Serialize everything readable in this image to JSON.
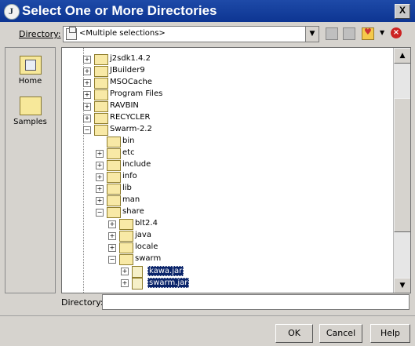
{
  "window": {
    "title": "Select One or More Directories",
    "close": "X"
  },
  "toolbar": {
    "directory_label": "Directory:",
    "combo_value": "<Multiple selections>",
    "combo_arrow": "▼",
    "fav_arrow": "▼",
    "delete_symbol": "×"
  },
  "places": [
    {
      "label": "Home",
      "icon": "home-folder-icon"
    },
    {
      "label": "Samples",
      "icon": "folder-icon"
    }
  ],
  "tree": {
    "nodes": [
      {
        "label": "j2sdk1.4.2",
        "level": 0,
        "expander": "+",
        "type": "folder"
      },
      {
        "label": "JBuilder9",
        "level": 0,
        "expander": "+",
        "type": "folder"
      },
      {
        "label": "MSOCache",
        "level": 0,
        "expander": "+",
        "type": "folder"
      },
      {
        "label": "Program Files",
        "level": 0,
        "expander": "+",
        "type": "folder"
      },
      {
        "label": "RAVBIN",
        "level": 0,
        "expander": "+",
        "type": "folder"
      },
      {
        "label": "RECYCLER",
        "level": 0,
        "expander": "+",
        "type": "folder"
      },
      {
        "label": "Swarm-2.2",
        "level": 0,
        "expander": "−",
        "type": "folder"
      },
      {
        "label": "bin",
        "level": 1,
        "expander": "",
        "type": "folder"
      },
      {
        "label": "etc",
        "level": 1,
        "expander": "+",
        "type": "folder"
      },
      {
        "label": "include",
        "level": 1,
        "expander": "+",
        "type": "folder"
      },
      {
        "label": "info",
        "level": 1,
        "expander": "+",
        "type": "folder"
      },
      {
        "label": "lib",
        "level": 1,
        "expander": "+",
        "type": "folder"
      },
      {
        "label": "man",
        "level": 1,
        "expander": "+",
        "type": "folder"
      },
      {
        "label": "share",
        "level": 1,
        "expander": "−",
        "type": "folder"
      },
      {
        "label": "blt2.4",
        "level": 2,
        "expander": "+",
        "type": "folder"
      },
      {
        "label": "java",
        "level": 2,
        "expander": "+",
        "type": "folder"
      },
      {
        "label": "locale",
        "level": 2,
        "expander": "+",
        "type": "folder"
      },
      {
        "label": "swarm",
        "level": 2,
        "expander": "−",
        "type": "folder"
      },
      {
        "label": "kawa.jar",
        "level": 3,
        "expander": "+",
        "type": "file",
        "selected": true
      },
      {
        "label": "swarm.jar",
        "level": 3,
        "expander": "+",
        "type": "file",
        "selected": true
      }
    ]
  },
  "scrollbar": {
    "up": "▲",
    "down": "▼"
  },
  "directory_field": {
    "label": "Directory:",
    "value": ""
  },
  "buttons": {
    "ok": "OK",
    "cancel": "Cancel",
    "help": "Help"
  }
}
